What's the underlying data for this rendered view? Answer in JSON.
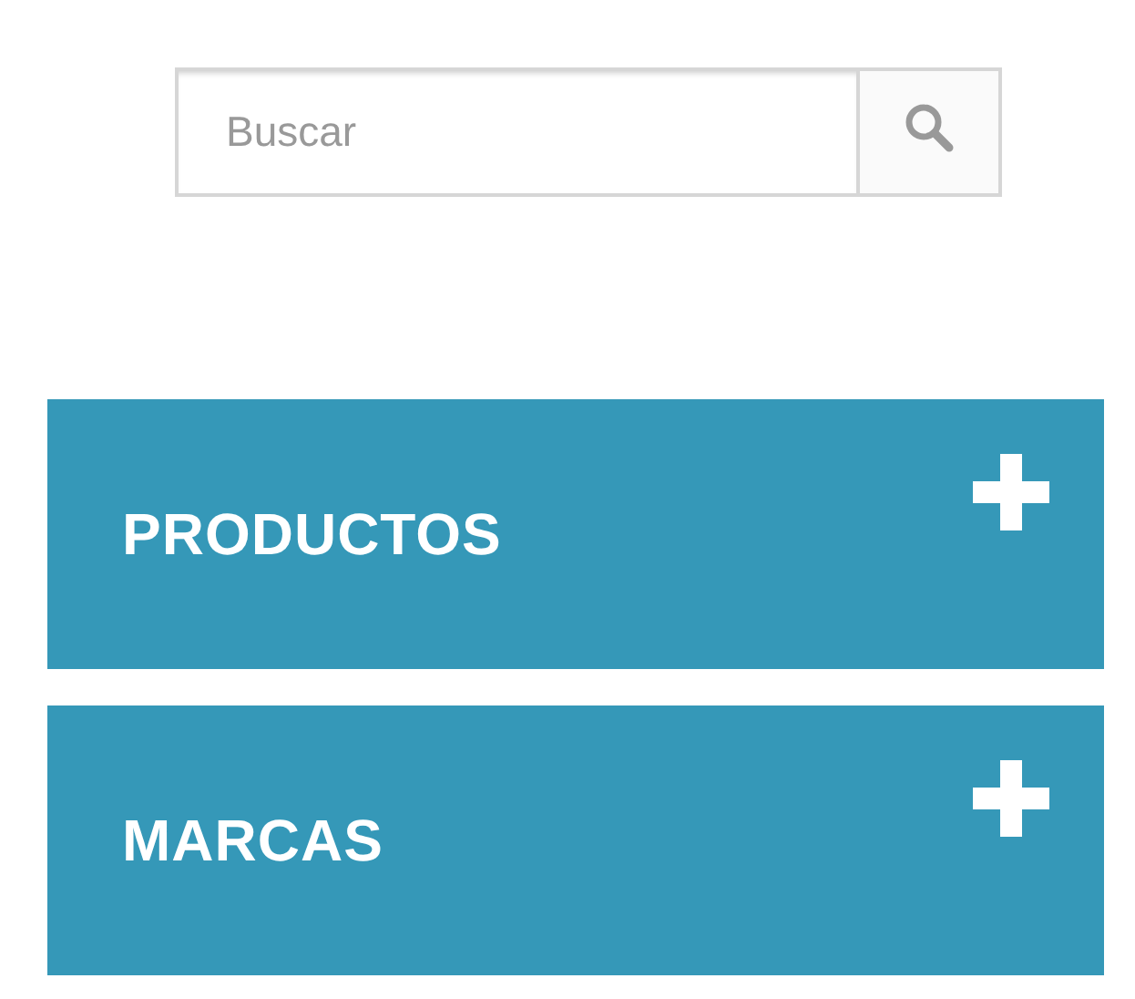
{
  "search": {
    "placeholder": "Buscar"
  },
  "accordion": [
    {
      "label": "PRODUCTOS",
      "expanded": false
    },
    {
      "label": "MARCAS",
      "expanded": false
    }
  ]
}
